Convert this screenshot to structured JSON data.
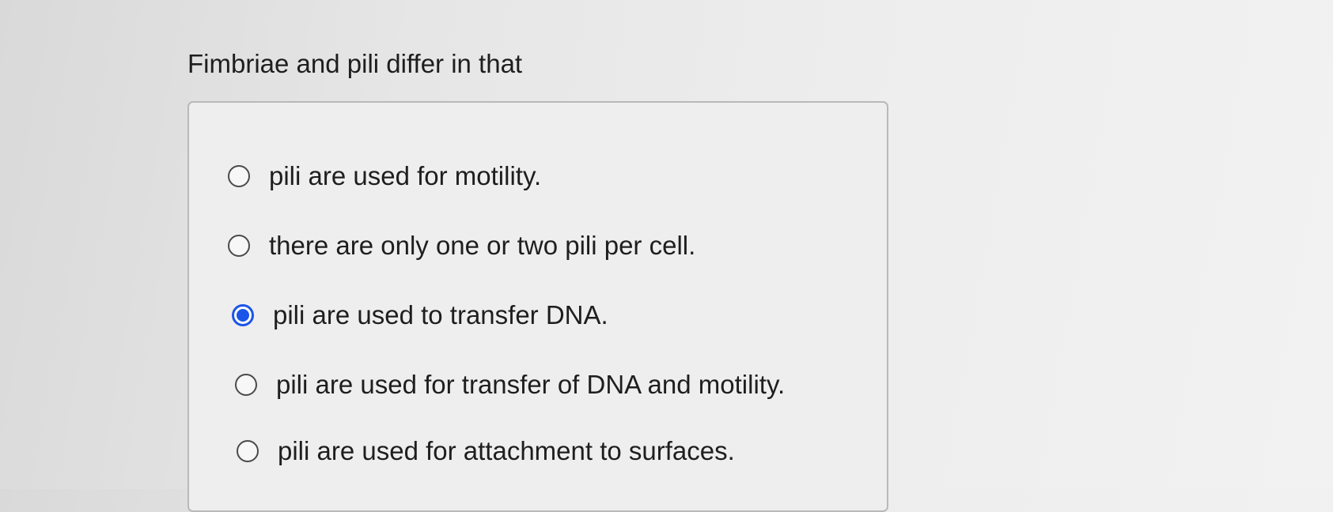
{
  "question": {
    "text": "Fimbriae and pili differ in that"
  },
  "options": [
    {
      "label": "pili are used for motility.",
      "selected": false
    },
    {
      "label": "there are only one or two pili per cell.",
      "selected": false
    },
    {
      "label": "pili are used to transfer DNA.",
      "selected": true
    },
    {
      "label": "pili are used for transfer of DNA and motility.",
      "selected": false
    },
    {
      "label": "pili are used for attachment to surfaces.",
      "selected": false
    }
  ],
  "colors": {
    "selected_radio": "#1a55e8",
    "unselected_radio_border": "#4a4a4a",
    "text": "#1e1e1e"
  },
  "icons": {
    "radio_unselected": "radio-unselected-icon",
    "radio_selected": "radio-selected-icon"
  }
}
